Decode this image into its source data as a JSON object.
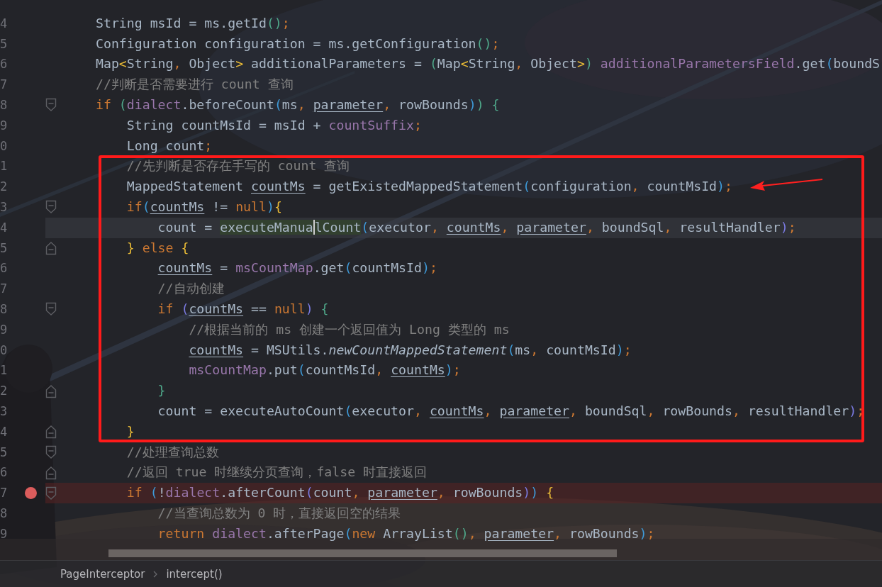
{
  "editor": {
    "lines": [
      {
        "number": "4",
        "fold_start": false,
        "fold_end": false,
        "current": false,
        "breakpoint": false,
        "tokens": [
          {
            "text": "String msId = ms.getId",
            "kind": "plain"
          },
          {
            "text": "()",
            "kind": "p_g"
          },
          {
            "text": ";",
            "kind": "punct"
          }
        ]
      },
      {
        "number": "5",
        "fold_start": false,
        "fold_end": false,
        "current": false,
        "breakpoint": false,
        "tokens": [
          {
            "text": "Configuration configuration = ms.getConfiguration",
            "kind": "plain"
          },
          {
            "text": "()",
            "kind": "p_g"
          },
          {
            "text": ";",
            "kind": "punct"
          }
        ]
      },
      {
        "number": "6",
        "fold_start": false,
        "fold_end": false,
        "current": false,
        "breakpoint": false,
        "tokens": [
          {
            "text": "Map",
            "kind": "plain"
          },
          {
            "text": "<",
            "kind": "p_y"
          },
          {
            "text": "String",
            "kind": "plain"
          },
          {
            "text": ", ",
            "kind": "punct"
          },
          {
            "text": "Object",
            "kind": "plain"
          },
          {
            "text": ">",
            "kind": "p_y"
          },
          {
            "text": " additionalParameters = ",
            "kind": "plain"
          },
          {
            "text": "(",
            "kind": "p_g"
          },
          {
            "text": "Map",
            "kind": "plain"
          },
          {
            "text": "<",
            "kind": "p_y"
          },
          {
            "text": "String",
            "kind": "plain"
          },
          {
            "text": ", ",
            "kind": "punct"
          },
          {
            "text": "Object",
            "kind": "plain"
          },
          {
            "text": ">",
            "kind": "p_y"
          },
          {
            "text": ")",
            "kind": "p_g"
          },
          {
            "text": " additionalParametersField",
            "kind": "field"
          },
          {
            "text": ".get",
            "kind": "plain"
          },
          {
            "text": "(",
            "kind": "p_b"
          },
          {
            "text": "boundS",
            "kind": "plain"
          }
        ]
      },
      {
        "number": "7",
        "fold_start": false,
        "fold_end": false,
        "current": false,
        "breakpoint": false,
        "tokens": [
          {
            "text": "//判断是否需要进行 count 查询",
            "kind": "comment"
          }
        ]
      },
      {
        "number": "8",
        "fold_start": true,
        "fold_end": false,
        "current": false,
        "breakpoint": false,
        "tokens": [
          {
            "text": "if",
            "kind": "kw"
          },
          {
            "text": " (",
            "kind": "p_g"
          },
          {
            "text": "dialect",
            "kind": "field"
          },
          {
            "text": ".beforeCount",
            "kind": "plain"
          },
          {
            "text": "(",
            "kind": "p_b"
          },
          {
            "text": "ms",
            "kind": "plain"
          },
          {
            "text": ", ",
            "kind": "punct"
          },
          {
            "text": "parameter",
            "kind": "ul"
          },
          {
            "text": ", ",
            "kind": "punct"
          },
          {
            "text": "rowBounds",
            "kind": "plain"
          },
          {
            "text": ")",
            "kind": "p_b"
          },
          {
            "text": ")",
            "kind": "p_g"
          },
          {
            "text": " {",
            "kind": "p_g"
          }
        ]
      },
      {
        "number": "9",
        "fold_start": false,
        "fold_end": false,
        "current": false,
        "breakpoint": false,
        "tokens": [
          {
            "text": "    String countMsId = msId + ",
            "kind": "plain"
          },
          {
            "text": "countSuffix",
            "kind": "field"
          },
          {
            "text": ";",
            "kind": "punct"
          }
        ]
      },
      {
        "number": "0",
        "fold_start": false,
        "fold_end": false,
        "current": false,
        "breakpoint": false,
        "tokens": [
          {
            "text": "    Long count",
            "kind": "plain"
          },
          {
            "text": ";",
            "kind": "punct"
          }
        ]
      },
      {
        "number": "1",
        "fold_start": false,
        "fold_end": false,
        "current": false,
        "breakpoint": false,
        "tokens": [
          {
            "text": "    //先判断是否存在手写的 count 查询",
            "kind": "comment"
          }
        ]
      },
      {
        "number": "2",
        "fold_start": false,
        "fold_end": false,
        "current": false,
        "breakpoint": false,
        "tokens": [
          {
            "text": "    MappedStatement ",
            "kind": "plain"
          },
          {
            "text": "countMs",
            "kind": "ul"
          },
          {
            "text": " = getExistedMappedStatement",
            "kind": "plain"
          },
          {
            "text": "(",
            "kind": "p_b"
          },
          {
            "text": "configuration",
            "kind": "plain"
          },
          {
            "text": ", ",
            "kind": "punct"
          },
          {
            "text": "countMsId",
            "kind": "plain"
          },
          {
            "text": ")",
            "kind": "p_b"
          },
          {
            "text": ";",
            "kind": "punct"
          }
        ]
      },
      {
        "number": "3",
        "fold_start": true,
        "fold_end": false,
        "current": false,
        "breakpoint": false,
        "tokens": [
          {
            "text": "    if",
            "kind": "kw"
          },
          {
            "text": "(",
            "kind": "p_b"
          },
          {
            "text": "countMs",
            "kind": "ul"
          },
          {
            "text": " != ",
            "kind": "plain"
          },
          {
            "text": "null",
            "kind": "kw"
          },
          {
            "text": ")",
            "kind": "p_b"
          },
          {
            "text": "{",
            "kind": "p_y"
          }
        ]
      },
      {
        "number": "4",
        "fold_start": false,
        "fold_end": false,
        "current": true,
        "breakpoint": false,
        "tokens": [
          {
            "text": "        count = ",
            "kind": "plain"
          },
          {
            "text": "executeManua",
            "kind": "match",
            "caret": true
          },
          {
            "text": "lCount",
            "kind": "match",
            "caret": false
          },
          {
            "text": "(",
            "kind": "p_b"
          },
          {
            "text": "executor",
            "kind": "plain"
          },
          {
            "text": ", ",
            "kind": "punct"
          },
          {
            "text": "countMs",
            "kind": "ul"
          },
          {
            "text": ", ",
            "kind": "punct"
          },
          {
            "text": "parameter",
            "kind": "ul"
          },
          {
            "text": ", ",
            "kind": "punct"
          },
          {
            "text": "boundSql",
            "kind": "plain"
          },
          {
            "text": ", ",
            "kind": "punct"
          },
          {
            "text": "resultHandler",
            "kind": "plain"
          },
          {
            "text": ")",
            "kind": "p_v"
          },
          {
            "text": ";",
            "kind": "punct"
          }
        ]
      },
      {
        "number": "5",
        "fold_start": false,
        "fold_end": true,
        "current": false,
        "breakpoint": false,
        "tokens": [
          {
            "text": "    }",
            "kind": "p_y"
          },
          {
            "text": " else",
            "kind": "kw"
          },
          {
            "text": " {",
            "kind": "p_y"
          }
        ]
      },
      {
        "number": "6",
        "fold_start": false,
        "fold_end": false,
        "current": false,
        "breakpoint": false,
        "tokens": [
          {
            "text": "        countMs",
            "kind": "ul"
          },
          {
            "text": " = ",
            "kind": "plain"
          },
          {
            "text": "msCountMap",
            "kind": "field"
          },
          {
            "text": ".get",
            "kind": "plain"
          },
          {
            "text": "(",
            "kind": "p_b"
          },
          {
            "text": "countMsId",
            "kind": "plain"
          },
          {
            "text": ")",
            "kind": "p_b"
          },
          {
            "text": ";",
            "kind": "punct"
          }
        ]
      },
      {
        "number": "7",
        "fold_start": false,
        "fold_end": false,
        "current": false,
        "breakpoint": false,
        "tokens": [
          {
            "text": "        //自动创建",
            "kind": "comment"
          }
        ]
      },
      {
        "number": "8",
        "fold_start": true,
        "fold_end": false,
        "current": false,
        "breakpoint": false,
        "tokens": [
          {
            "text": "        if",
            "kind": "kw"
          },
          {
            "text": " (",
            "kind": "p_v"
          },
          {
            "text": "countMs",
            "kind": "ul"
          },
          {
            "text": " == ",
            "kind": "plain"
          },
          {
            "text": "null",
            "kind": "kw"
          },
          {
            "text": ")",
            "kind": "p_v"
          },
          {
            "text": " {",
            "kind": "p_g"
          }
        ]
      },
      {
        "number": "9",
        "fold_start": false,
        "fold_end": false,
        "current": false,
        "breakpoint": false,
        "tokens": [
          {
            "text": "            //根据当前的 ms 创建一个返回值为 Long 类型的 ms",
            "kind": "comment"
          }
        ]
      },
      {
        "number": "0",
        "fold_start": false,
        "fold_end": false,
        "current": false,
        "breakpoint": false,
        "tokens": [
          {
            "text": "            countMs",
            "kind": "ul"
          },
          {
            "text": " = MSUtils.",
            "kind": "plain"
          },
          {
            "text": "newCountMappedStatement",
            "kind": "static"
          },
          {
            "text": "(",
            "kind": "p_b"
          },
          {
            "text": "ms",
            "kind": "plain"
          },
          {
            "text": ", ",
            "kind": "punct"
          },
          {
            "text": "countMsId",
            "kind": "plain"
          },
          {
            "text": ")",
            "kind": "p_b"
          },
          {
            "text": ";",
            "kind": "punct"
          }
        ]
      },
      {
        "number": "1",
        "fold_start": false,
        "fold_end": false,
        "current": false,
        "breakpoint": false,
        "tokens": [
          {
            "text": "            msCountMap",
            "kind": "field"
          },
          {
            "text": ".put",
            "kind": "plain"
          },
          {
            "text": "(",
            "kind": "p_b"
          },
          {
            "text": "countMsId",
            "kind": "plain"
          },
          {
            "text": ", ",
            "kind": "punct"
          },
          {
            "text": "countMs",
            "kind": "ul"
          },
          {
            "text": ")",
            "kind": "p_b"
          },
          {
            "text": ";",
            "kind": "punct"
          }
        ]
      },
      {
        "number": "2",
        "fold_start": false,
        "fold_end": true,
        "current": false,
        "breakpoint": false,
        "tokens": [
          {
            "text": "        }",
            "kind": "p_g"
          }
        ]
      },
      {
        "number": "3",
        "fold_start": false,
        "fold_end": false,
        "current": false,
        "breakpoint": false,
        "tokens": [
          {
            "text": "        count = executeAutoCount",
            "kind": "plain"
          },
          {
            "text": "(",
            "kind": "p_b"
          },
          {
            "text": "executor",
            "kind": "plain"
          },
          {
            "text": ", ",
            "kind": "punct"
          },
          {
            "text": "countMs",
            "kind": "ul"
          },
          {
            "text": ", ",
            "kind": "punct"
          },
          {
            "text": "parameter",
            "kind": "ul"
          },
          {
            "text": ", ",
            "kind": "punct"
          },
          {
            "text": "boundSql",
            "kind": "plain"
          },
          {
            "text": ", ",
            "kind": "punct"
          },
          {
            "text": "rowBounds",
            "kind": "plain"
          },
          {
            "text": ", ",
            "kind": "punct"
          },
          {
            "text": "resultHandler",
            "kind": "plain"
          },
          {
            "text": ")",
            "kind": "p_v"
          },
          {
            "text": ";",
            "kind": "punct"
          }
        ]
      },
      {
        "number": "4",
        "fold_start": false,
        "fold_end": true,
        "current": false,
        "breakpoint": false,
        "tokens": [
          {
            "text": "    }",
            "kind": "p_y"
          }
        ]
      },
      {
        "number": "5",
        "fold_start": true,
        "fold_end": false,
        "current": false,
        "breakpoint": false,
        "tokens": [
          {
            "text": "    //处理查询总数",
            "kind": "comment"
          }
        ]
      },
      {
        "number": "6",
        "fold_start": false,
        "fold_end": true,
        "current": false,
        "breakpoint": false,
        "tokens": [
          {
            "text": "    //返回 true 时继续分页查询，false 时直接返回",
            "kind": "comment"
          }
        ]
      },
      {
        "number": "7",
        "fold_start": true,
        "fold_end": false,
        "current": false,
        "breakpoint": true,
        "tokens": [
          {
            "text": "    if",
            "kind": "kw"
          },
          {
            "text": " (",
            "kind": "p_b"
          },
          {
            "text": "!",
            "kind": "plain"
          },
          {
            "text": "dialect",
            "kind": "field"
          },
          {
            "text": ".afterCount",
            "kind": "plain"
          },
          {
            "text": "(",
            "kind": "p_v"
          },
          {
            "text": "count",
            "kind": "plain"
          },
          {
            "text": ", ",
            "kind": "punct"
          },
          {
            "text": "parameter",
            "kind": "ul"
          },
          {
            "text": ", ",
            "kind": "punct"
          },
          {
            "text": "rowBounds",
            "kind": "plain"
          },
          {
            "text": ")",
            "kind": "p_v"
          },
          {
            "text": ")",
            "kind": "p_b"
          },
          {
            "text": " {",
            "kind": "p_y"
          }
        ]
      },
      {
        "number": "8",
        "fold_start": false,
        "fold_end": false,
        "current": false,
        "breakpoint": false,
        "tokens": [
          {
            "text": "        //当查询总数为 0 时，直接返回空的结果",
            "kind": "comment"
          }
        ]
      },
      {
        "number": "9",
        "fold_start": false,
        "fold_end": false,
        "current": false,
        "breakpoint": false,
        "tokens": [
          {
            "text": "        return",
            "kind": "kw"
          },
          {
            "text": " dialect",
            "kind": "field"
          },
          {
            "text": ".afterPage",
            "kind": "plain"
          },
          {
            "text": "(",
            "kind": "p_b"
          },
          {
            "text": "new",
            "kind": "kw"
          },
          {
            "text": " ArrayList",
            "kind": "plain"
          },
          {
            "text": "()",
            "kind": "p_g"
          },
          {
            "text": ", ",
            "kind": "punct"
          },
          {
            "text": "parameter",
            "kind": "ul"
          },
          {
            "text": ", ",
            "kind": "punct"
          },
          {
            "text": "rowBounds",
            "kind": "plain"
          },
          {
            "text": ")",
            "kind": "p_b"
          },
          {
            "text": ";",
            "kind": "punct"
          }
        ]
      }
    ]
  },
  "breadcrumbs": [
    "PageInterceptor",
    "intercept()"
  ]
}
